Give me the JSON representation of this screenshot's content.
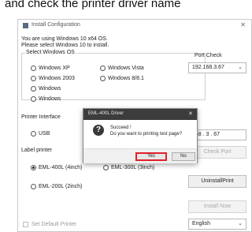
{
  "caption": "and check the printer driver name",
  "window": {
    "title": "Install Configuration",
    "close_glyph": "✕",
    "intro_line1": "You are using Windows 10 x64 OS.",
    "intro_line2": "Please select Windows 10 to install.",
    "os_group": {
      "label": "Select Windows OS",
      "options": [
        "Windows XP",
        "Windows 2003",
        "Windows",
        "Windows",
        "Windows Vista",
        "Windows 8/8.1"
      ]
    },
    "port_check": {
      "label": "Port Check",
      "ip_value": "192.168.3.67"
    },
    "printer_interface": {
      "label": "Printer Interface",
      "usb_label": "USB",
      "ip_partial": "168 . 3 . 67"
    },
    "label_printer": {
      "label": "Label printer",
      "options": [
        "EML-400L (4inch)",
        "EML-300L (3inch)",
        "EML-200L (2inch)"
      ]
    },
    "buttons": {
      "check_port": "Check Port",
      "uninstall": "UninstallPrint",
      "install_now": "Install Now"
    },
    "default_printer_label": "Set Default Printer",
    "language": "English"
  },
  "dialog": {
    "title": "EML-400L Driver",
    "close_glyph": "✕",
    "icon_glyph": "?",
    "message_line1": "Succeed !",
    "message_line2": "Do you want to printing test page?",
    "yes_label": "Yes",
    "no_label": "No"
  },
  "colors": {
    "highlight": "#e0202a",
    "dialog_titlebar": "#3c3c3c"
  }
}
